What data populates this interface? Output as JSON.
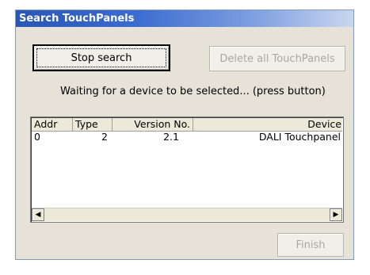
{
  "window": {
    "title": "Search TouchPanels"
  },
  "buttons": {
    "stop_search": "Stop search",
    "delete_all": "Delete all TouchPanels",
    "finish": "Finish"
  },
  "status_text": "Waiting for a device to be selected... (press button)",
  "table": {
    "columns": [
      "Addr",
      "Type",
      "Version No.",
      "Device"
    ],
    "rows": [
      {
        "addr": "0",
        "type": "2",
        "version": "2.1",
        "device": "DALI Touchpanel"
      }
    ]
  },
  "scrollbar": {
    "left_icon": "arrow-left-icon",
    "right_icon": "arrow-right-icon"
  },
  "colors": {
    "title_bar": "#2a57b5",
    "window_bg": "#e6e2d8"
  }
}
